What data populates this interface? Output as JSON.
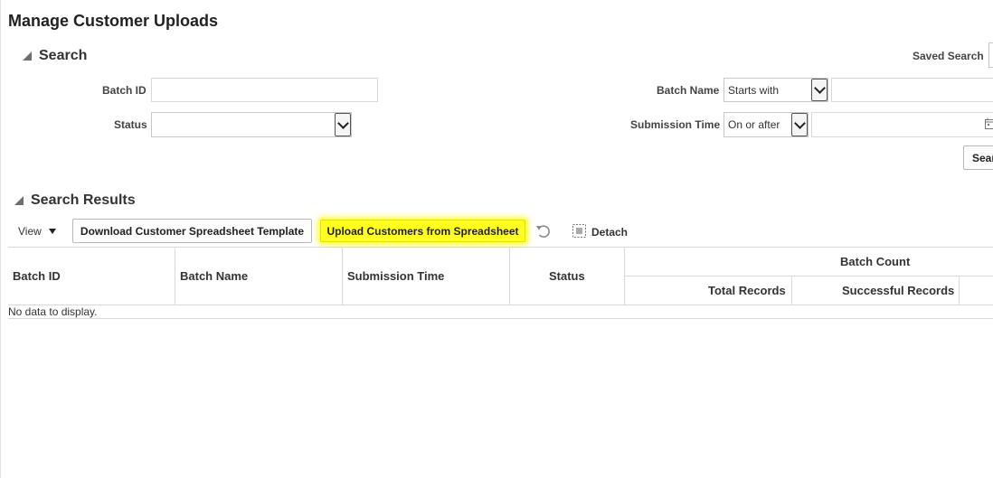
{
  "page": {
    "title": "Manage Customer Uploads"
  },
  "search": {
    "header": "Search",
    "saved_search_label": "Saved Search",
    "batch_id_label": "Batch ID",
    "batch_id_value": "",
    "status_label": "Status",
    "status_value": "",
    "batch_name_label": "Batch Name",
    "batch_name_operator": "Starts with",
    "batch_name_value": "",
    "submission_time_label": "Submission Time",
    "submission_time_operator": "On or after",
    "submission_time_value": "",
    "search_button": "Sear"
  },
  "results": {
    "header": "Search Results",
    "toolbar": {
      "view_label": "View",
      "download_button": "Download Customer Spreadsheet Template",
      "upload_button": "Upload Customers from Spreadsheet",
      "detach_label": "Detach"
    },
    "table": {
      "columns": {
        "batch_id": "Batch ID",
        "batch_name": "Batch Name",
        "submission_time": "Submission Time",
        "status": "Status",
        "batch_count": "Batch Count",
        "total_records": "Total Records",
        "successful_records": "Successful Records"
      },
      "rows": [],
      "empty_text": "No data to display."
    }
  },
  "colors": {
    "highlight": "#ffff22"
  }
}
